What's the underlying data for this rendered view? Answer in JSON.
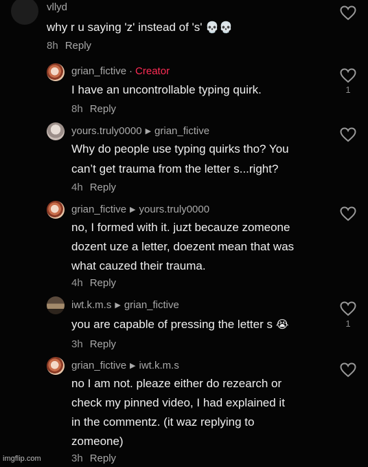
{
  "comments": [
    {
      "username": "vllyd",
      "text": "why r u saying 'z' instead of 's'",
      "emoji": "💀💀",
      "time": "8h",
      "reply": "Reply"
    },
    {
      "username": "grian_fictive",
      "badge": "Creator",
      "badge_sep": "·",
      "text": "I have an uncontrollable typing quirk.",
      "time": "8h",
      "reply": "Reply",
      "likes": "1"
    },
    {
      "username": "yours.truly0000",
      "reply_to": "grian_fictive",
      "text_lines": [
        "Why do people use typing quirks tho? You",
        "can’t get trauma from the letter s...right?"
      ],
      "time": "4h",
      "reply": "Reply"
    },
    {
      "username": "grian_fictive",
      "reply_to": "yours.truly0000",
      "text_lines": [
        "no, I formed with it. juzt becauze zomeone",
        "dozent uze a letter, doezent mean that was",
        "what cauzed their trauma."
      ],
      "time": "4h",
      "reply": "Reply"
    },
    {
      "username": "iwt.k.m.s",
      "reply_to": "grian_fictive",
      "text": "you are capable of pressing the letter s",
      "emoji": "😭",
      "time": "3h",
      "reply": "Reply",
      "likes": "1"
    },
    {
      "username": "grian_fictive",
      "reply_to": "iwt.k.m.s",
      "text_lines": [
        "no I am not. pleaze either do rezearch or",
        "check my pinned video, I had explained it",
        "in the commentz. (it waz replying to",
        "zomeone)"
      ],
      "time": "3h",
      "reply": "Reply"
    }
  ],
  "icons": {
    "like": "heart-outline-icon",
    "reply_arrow": "triangle-right-icon"
  },
  "colors": {
    "background": "#050505",
    "creator": "#fe2c55",
    "text": "#efefef",
    "muted": "#a9a9a9"
  },
  "watermark": "imgflip.com"
}
